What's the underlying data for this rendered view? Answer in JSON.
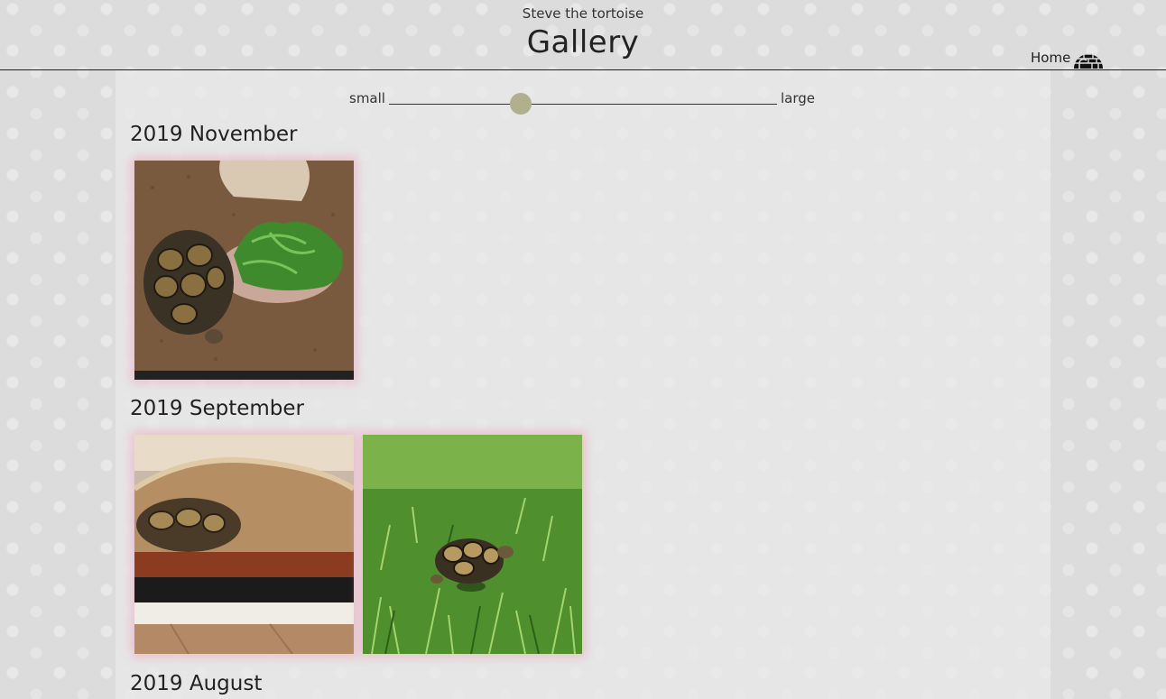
{
  "header": {
    "subtitle": "Steve the tortoise",
    "title": "Gallery",
    "home_label": "Home",
    "home_icon": "igloo-icon"
  },
  "size_slider": {
    "min_label": "small",
    "max_label": "large",
    "value_fraction": 0.34
  },
  "sections": [
    {
      "title": "2019 November",
      "photos": [
        "tortoise beside a dish of leafy greens on substrate"
      ]
    },
    {
      "title": "2019 September",
      "photos": [
        "tortoise hiding under a hide in the enclosure",
        "tortoise walking on green grass"
      ]
    },
    {
      "title": "2019 August",
      "photos": []
    }
  ],
  "colors": {
    "slider_thumb": "#b0b08f",
    "photo_glow": "#ecaabe"
  }
}
